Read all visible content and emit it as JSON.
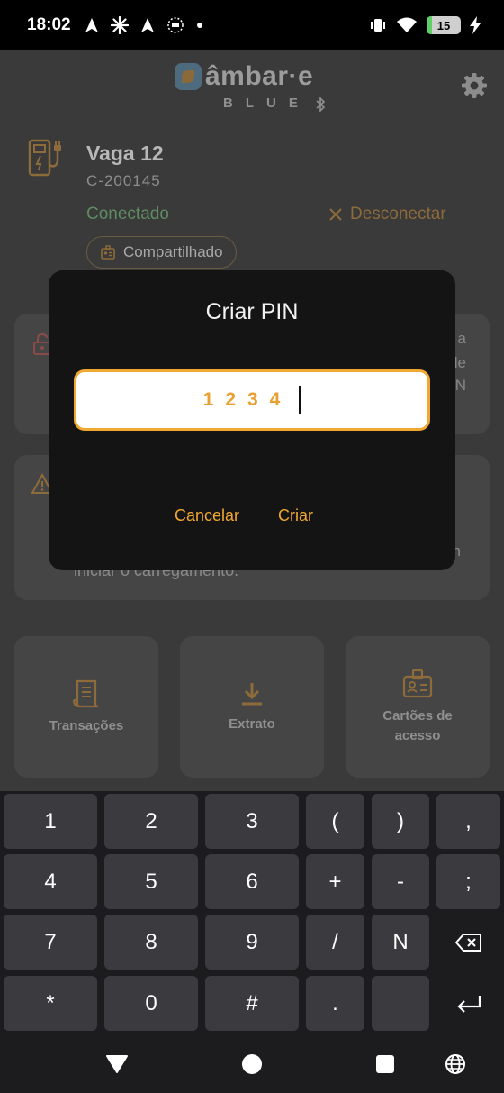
{
  "status_bar": {
    "time": "18:02",
    "battery": "15",
    "battery_level": 0.15
  },
  "header": {
    "brand": "âmbar·e",
    "subtitle": "BLUE"
  },
  "station": {
    "name": "Vaga 12",
    "code": "C-200145",
    "status": "Conectado",
    "disconnect_label": "Desconectar",
    "shared_label": "Compartilhado"
  },
  "card1": {
    "edge_text": [
      "a",
      "de",
      "N"
    ]
  },
  "card2": {
    "edge_text": "n",
    "text": "iniciar o carregamento."
  },
  "tiles": [
    {
      "label": "Transações",
      "icon": "receipt-icon"
    },
    {
      "label": "Extrato",
      "icon": "download-icon"
    },
    {
      "label": "Cartões de acesso",
      "icon": "access-card-icon"
    }
  ],
  "dialog": {
    "title": "Criar PIN",
    "pin_value": "1234",
    "cancel_label": "Cancelar",
    "create_label": "Criar"
  },
  "keyboard": {
    "rows": [
      [
        "1",
        "2",
        "3",
        "(",
        ")",
        ","
      ],
      [
        "4",
        "5",
        "6",
        "+",
        "-",
        ";"
      ],
      [
        "7",
        "8",
        "9",
        "/",
        "N",
        "⌫"
      ],
      [
        "*",
        "0",
        "#",
        ".",
        "",
        "↵"
      ]
    ]
  },
  "colors": {
    "accent": "#f0a830",
    "connected": "#5e8b62",
    "dialog_bg": "#141414"
  }
}
